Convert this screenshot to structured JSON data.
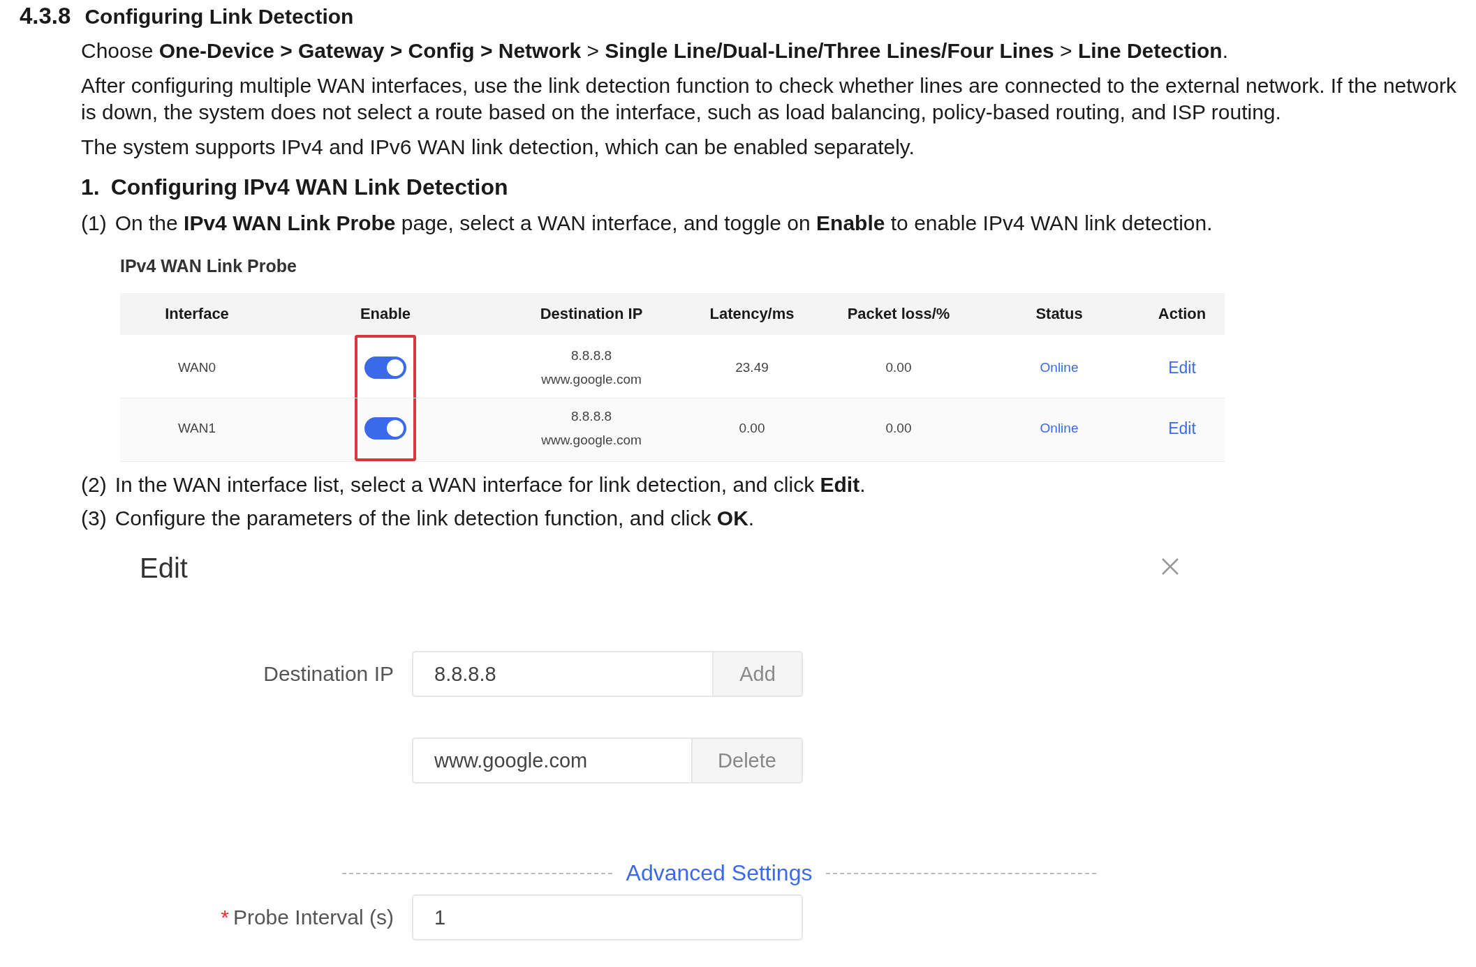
{
  "heading": {
    "number": "4.3.8",
    "title": "Configuring Link Detection"
  },
  "intro": [
    "Choose **One-Device > Gateway > Config > Network** > **Single Line/Dual-Line/Three Lines/Four Lines** > **Line Detection**.",
    "After configuring multiple WAN interfaces, use the link detection function to check whether lines are connected to the external network. If the network is down, the system does not select a route based on the interface, such as load balancing, policy-based routing, and ISP routing.",
    "The system supports IPv4 and IPv6 WAN link detection, which can be enabled separately."
  ],
  "subheading": {
    "number": "1.",
    "title": "Configuring IPv4 WAN Link Detection"
  },
  "step_1": {
    "number": "(1)",
    "text": "On the **IPv4 WAN Link Probe** page, select a WAN interface, and toggle on **Enable** to enable IPv4 WAN link detection."
  },
  "probe_table": {
    "title": "IPv4 WAN Link Probe",
    "columns": [
      {
        "label": "Interface",
        "highlighted": false
      },
      {
        "label": "Enable",
        "highlighted": true
      },
      {
        "label": "Destination IP",
        "highlighted": false
      },
      {
        "label": "Latency/ms",
        "highlighted": false
      },
      {
        "label": "Packet loss/%",
        "highlighted": false
      },
      {
        "label": "Status",
        "highlighted": false
      },
      {
        "label": "Action",
        "highlighted": false
      }
    ],
    "rows": [
      {
        "interface": "WAN0",
        "enabled": true,
        "destinations": [
          "8.8.8.8",
          "www.google.com"
        ],
        "latency": "23.49",
        "packet_loss": "0.00",
        "status": "Online",
        "action": "Edit"
      },
      {
        "interface": "WAN1",
        "enabled": true,
        "destinations": [
          "8.8.8.8",
          "www.google.com"
        ],
        "latency": "0.00",
        "packet_loss": "0.00",
        "status": "Online",
        "action": "Edit"
      }
    ]
  },
  "steps": [
    {
      "number": "(2)",
      "text": "In the WAN interface list, select a WAN interface for link detection, and click **Edit**."
    },
    {
      "number": "(3)",
      "text": "Configure the parameters of the link detection function, and click **OK**."
    }
  ],
  "edit_dialog": {
    "title": "Edit",
    "destinations": [
      {
        "label": "Destination IP",
        "value": "8.8.8.8",
        "button": "Add"
      },
      {
        "value": "www.google.com",
        "button": "Delete"
      }
    ],
    "advanced_label": "Advanced Settings",
    "probe_interval": {
      "required_mark": "*",
      "label": "Probe Interval (s)",
      "value": "1"
    }
  }
}
